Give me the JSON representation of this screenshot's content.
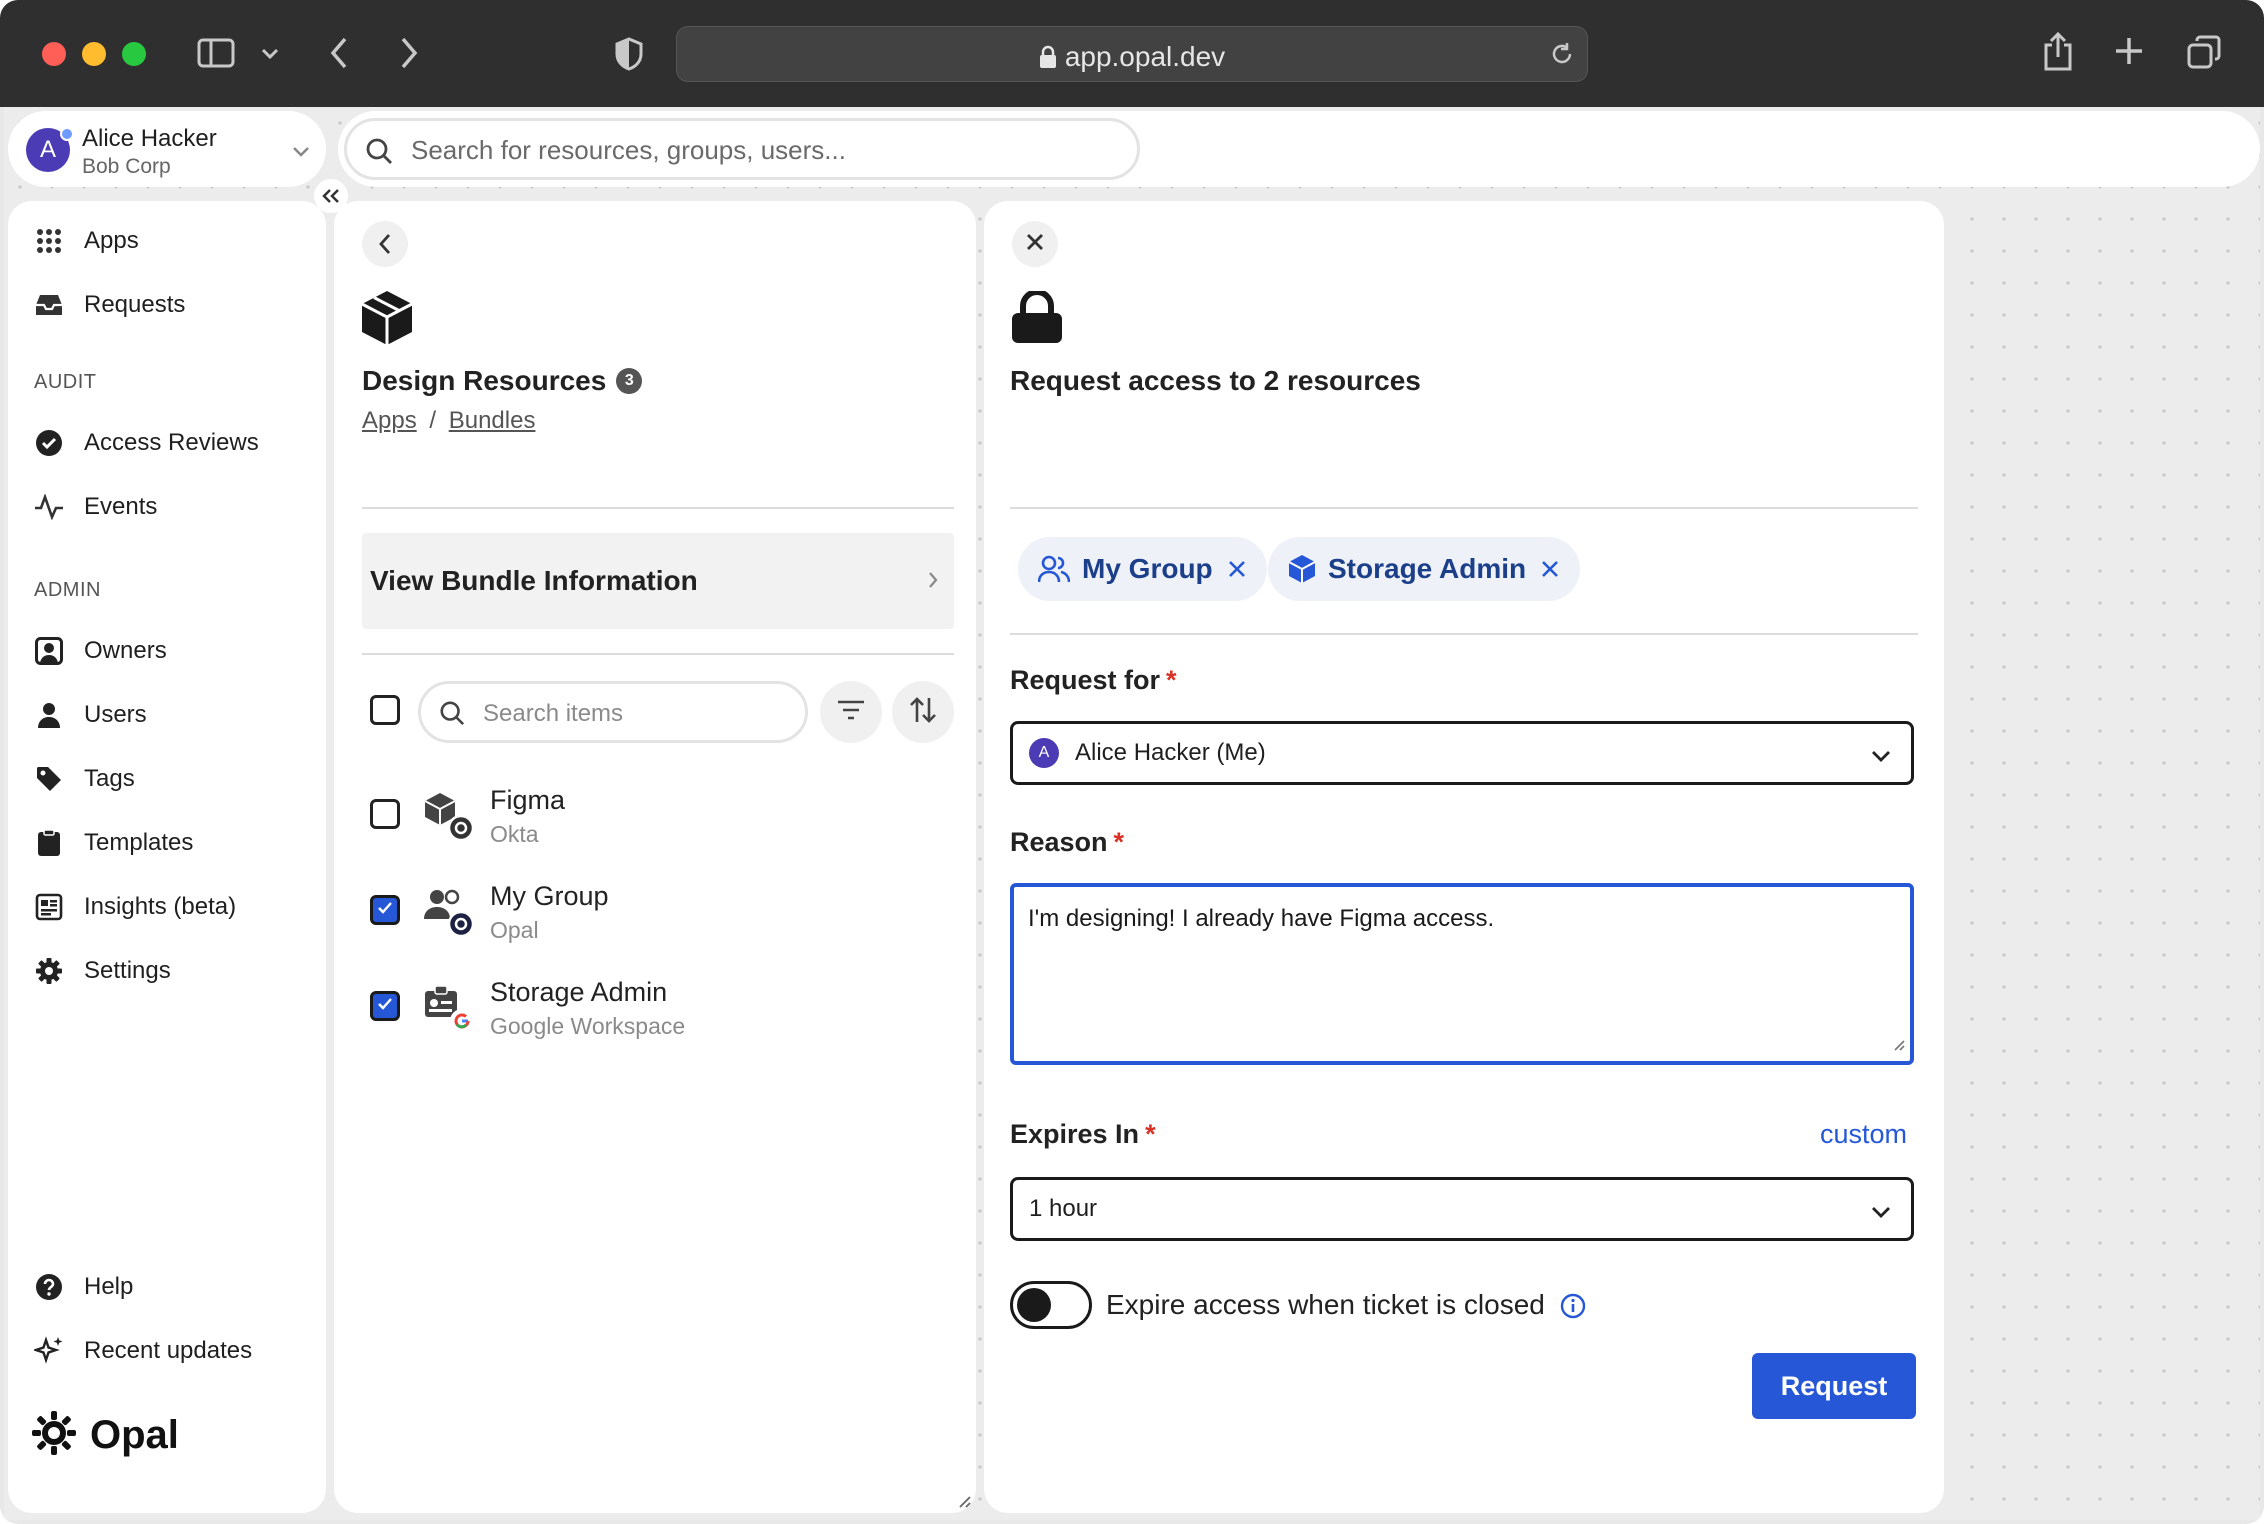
{
  "browser": {
    "url": "app.opal.dev"
  },
  "account": {
    "avatar_letter": "A",
    "name": "Alice Hacker",
    "org": "Bob Corp"
  },
  "global_search": {
    "placeholder": "Search for resources, groups, users..."
  },
  "sidebar": {
    "top_items": [
      {
        "label": "Apps",
        "icon": "grid-icon"
      },
      {
        "label": "Requests",
        "icon": "inbox-icon"
      }
    ],
    "audit_label": "AUDIT",
    "audit_items": [
      {
        "label": "Access Reviews",
        "icon": "check-circle-icon"
      },
      {
        "label": "Events",
        "icon": "activity-icon"
      }
    ],
    "admin_label": "ADMIN",
    "admin_items": [
      {
        "label": "Owners",
        "icon": "owner-icon"
      },
      {
        "label": "Users",
        "icon": "user-icon"
      },
      {
        "label": "Tags",
        "icon": "tag-icon"
      },
      {
        "label": "Templates",
        "icon": "clipboard-icon"
      },
      {
        "label": "Insights (beta)",
        "icon": "insights-icon"
      },
      {
        "label": "Settings",
        "icon": "gear-icon"
      }
    ],
    "bottom_items": [
      {
        "label": "Help",
        "icon": "help-icon"
      },
      {
        "label": "Recent updates",
        "icon": "sparkle-icon"
      }
    ],
    "brand": "Opal"
  },
  "bundle": {
    "title": "Design Resources",
    "count": "3",
    "breadcrumb": [
      "Apps",
      "Bundles"
    ],
    "breadcrumb_sep": "/",
    "view_info_label": "View Bundle Information",
    "search_placeholder": "Search items",
    "items": [
      {
        "name": "Figma",
        "source": "Okta",
        "checked": false
      },
      {
        "name": "My Group",
        "source": "Opal",
        "checked": true
      },
      {
        "name": "Storage Admin",
        "source": "Google Workspace",
        "checked": true
      }
    ]
  },
  "request_form": {
    "title": "Request access to 2 resources",
    "chips": [
      "My Group",
      "Storage Admin"
    ],
    "request_for_label": "Request for",
    "request_for_value": "Alice Hacker (Me)",
    "request_for_avatar": "A",
    "reason_label": "Reason",
    "reason_value": "I'm designing! I already have Figma access.",
    "expires_label": "Expires In",
    "custom_link": "custom",
    "expires_value": "1 hour",
    "toggle_label": "Expire access when ticket is closed",
    "toggle_on": false,
    "submit_label": "Request",
    "required_mark": "*"
  },
  "colors": {
    "accent": "#2557d6",
    "required": "#d93025",
    "chip_text": "#1c3f8a",
    "avatar": "#4b3bb5"
  }
}
